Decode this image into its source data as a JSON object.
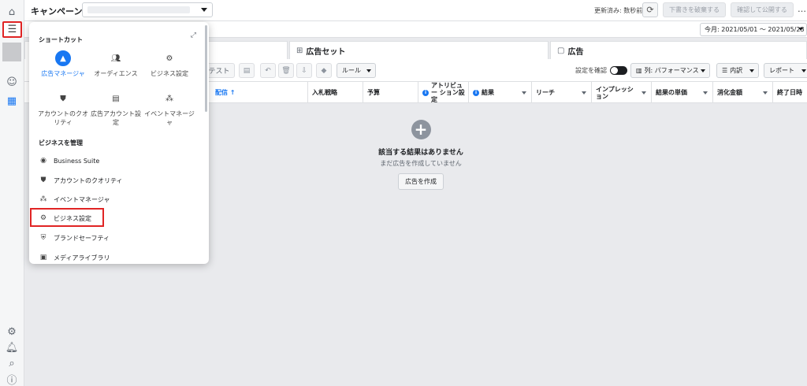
{
  "topbar": {
    "title": "キャンペーン",
    "updated_label": "更新済み: 数秒前",
    "discard_label": "下書きを破棄する",
    "publish_label": "確認して公開する",
    "more_label": "…"
  },
  "search": {
    "date_range": "今月: 2021/05/01 ～ 2021/05/23"
  },
  "tabs": {
    "adset": "広告セット",
    "ad": "広告"
  },
  "toolbar": {
    "test_label": "テスト",
    "rules_label": "ルール",
    "settings_check_label": "設定を確認",
    "columns_label": "列: パフォーマンス",
    "breakdown_label": "内訳",
    "reports_label": "レポート"
  },
  "columns": {
    "delivery": "配信 ↑",
    "bid_strategy": "入札戦略",
    "budget": "予算",
    "attribution": "アトリビュー ション設定",
    "results": "結果",
    "reach": "リーチ",
    "impressions": "インプレッシ ョン",
    "cost_per_result": "結果の単価",
    "amount_spent": "消化金額",
    "end_date": "終了日時"
  },
  "empty_state": {
    "title": "該当する結果はありません",
    "subtitle": "まだ広告を作成していません",
    "button": "広告を作成"
  },
  "menu": {
    "shortcuts_title": "ショートカット",
    "shortcuts": [
      {
        "label": "広告マネージャ",
        "icon": "ads-manager-icon"
      },
      {
        "label": "オーディエンス",
        "icon": "audience-icon"
      },
      {
        "label": "ビジネス設定",
        "icon": "gear-icon"
      },
      {
        "label": "アカウントのクオリティ",
        "icon": "shield-icon"
      },
      {
        "label": "広告アカウント設定",
        "icon": "ad-account-icon"
      },
      {
        "label": "イベントマネージャ",
        "icon": "events-icon"
      }
    ],
    "manage_title": "ビジネスを管理",
    "manage_items": [
      {
        "label": "Business Suite",
        "icon": "business-suite-icon"
      },
      {
        "label": "アカウントのクオリティ",
        "icon": "shield-icon"
      },
      {
        "label": "イベントマネージャ",
        "icon": "events-icon"
      },
      {
        "label": "ビジネス設定",
        "icon": "gear-icon"
      },
      {
        "label": "ブランドセーフティ",
        "icon": "brand-safety-icon"
      },
      {
        "label": "メディアライブラリ",
        "icon": "media-library-icon"
      }
    ]
  },
  "colors": {
    "accent": "#1877f2",
    "highlight": "#e02424"
  }
}
